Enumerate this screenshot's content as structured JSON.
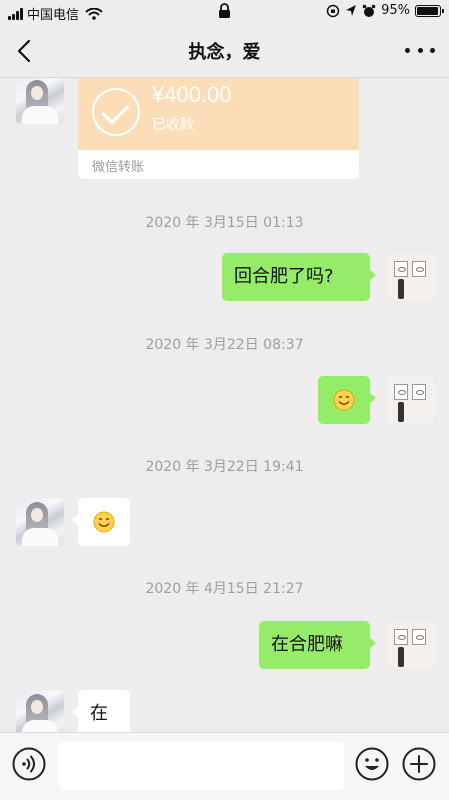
{
  "status_bar": {
    "carrier": "中国电信",
    "battery_percent": "95%",
    "battery_level": 0.95
  },
  "nav": {
    "title": "执念，爱",
    "back_icon": "chevron-left-icon",
    "more_icon": "more-dots-icon"
  },
  "transfer": {
    "amount": "¥400.00",
    "status": "已收款",
    "label": "微信转账"
  },
  "messages": [
    {
      "type": "timestamp",
      "text": "2020 年 3月15日 01:13"
    },
    {
      "type": "sent",
      "text": "回合肥了吗?"
    },
    {
      "type": "timestamp",
      "text": "2020 年 3月22日 08:37"
    },
    {
      "type": "sent",
      "emoji": "smiling-face-emoji"
    },
    {
      "type": "timestamp",
      "text": "2020 年 3月22日 19:41"
    },
    {
      "type": "received",
      "emoji": "smiling-face-emoji"
    },
    {
      "type": "timestamp",
      "text": "2020 年 4月15日 21:27"
    },
    {
      "type": "sent",
      "text": "在合肥嘛"
    },
    {
      "type": "received",
      "text": "在"
    }
  ],
  "input_bar": {
    "voice_icon": "voice-icon",
    "emoji_icon": "emoji-icon",
    "plus_icon": "plus-icon",
    "value": "",
    "placeholder": ""
  },
  "colors": {
    "background": "#ededed",
    "sent_bubble": "#95ec69",
    "received_bubble": "#ffffff",
    "transfer_card": "#fbdeb7"
  }
}
